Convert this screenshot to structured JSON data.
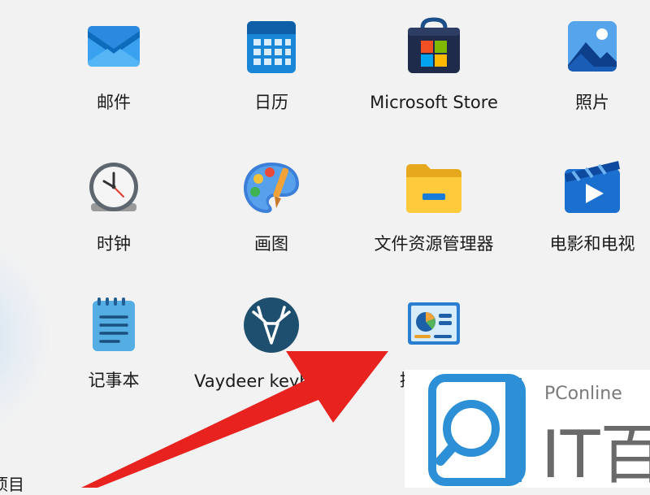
{
  "apps": [
    {
      "label": "邮件",
      "icon": "mail-icon"
    },
    {
      "label": "日历",
      "icon": "calendar-icon"
    },
    {
      "label": "Microsoft Store",
      "icon": "store-icon"
    },
    {
      "label": "照片",
      "icon": "photos-icon"
    },
    {
      "label": "时钟",
      "icon": "clock-icon"
    },
    {
      "label": "画图",
      "icon": "paint-icon"
    },
    {
      "label": "文件资源管理器",
      "icon": "folder-icon"
    },
    {
      "label": "电影和电视",
      "icon": "movies-icon"
    },
    {
      "label": "记事本",
      "icon": "notepad-icon"
    },
    {
      "label": "Vaydeer keyboard",
      "icon": "vaydeer-deer-icon"
    },
    {
      "label": "控制面板",
      "icon": "control-panel-icon"
    }
  ],
  "partial_label": "项目",
  "watermark": {
    "brand": "PConline",
    "sub": "IT百科"
  },
  "colors": {
    "arrow": "#e8231f",
    "watermark_blue": "#2d8fd5",
    "background": "#f2f2f2"
  }
}
